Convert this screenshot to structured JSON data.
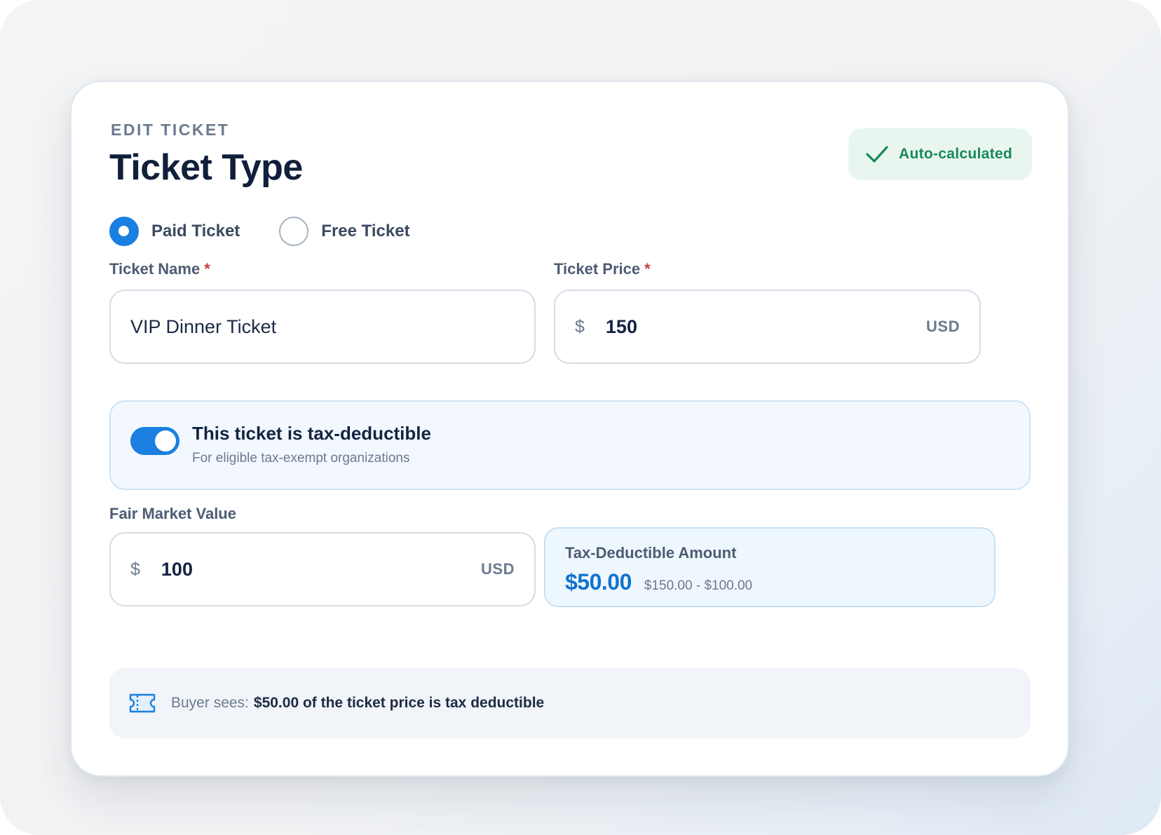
{
  "header": {
    "eyebrow": "EDIT TICKET",
    "title": "Ticket Type",
    "badge": "Auto-calculated"
  },
  "ticket_type": {
    "options": [
      {
        "label": "Paid Ticket",
        "checked": true
      },
      {
        "label": "Free Ticket",
        "checked": false
      }
    ]
  },
  "ticket_name": {
    "label": "Ticket Name",
    "required_mark": "*",
    "value": "VIP Dinner Ticket"
  },
  "ticket_price": {
    "label": "Ticket Price",
    "required_mark": "*",
    "currency_symbol": "$",
    "value": "150",
    "unit": "USD"
  },
  "tax_deductible": {
    "enabled": true,
    "title": "This ticket is tax-deductible",
    "subtitle": "For eligible tax-exempt organizations"
  },
  "fair_market_value": {
    "label": "Fair Market Value",
    "currency_symbol": "$",
    "value": "100",
    "unit": "USD"
  },
  "tax_amount": {
    "label": "Tax-Deductible Amount",
    "value": "$50.00",
    "calculation": "$150.00 - $100.00"
  },
  "buyer_notice": {
    "prefix": "Buyer sees:",
    "text": "$50.00 of the ticket price is tax deductible"
  },
  "colors": {
    "accent": "#1a7fe0",
    "success": "#178a55",
    "required": "#d03b3b"
  },
  "icons": {
    "badge": "check-icon",
    "notice": "ticket-icon"
  }
}
